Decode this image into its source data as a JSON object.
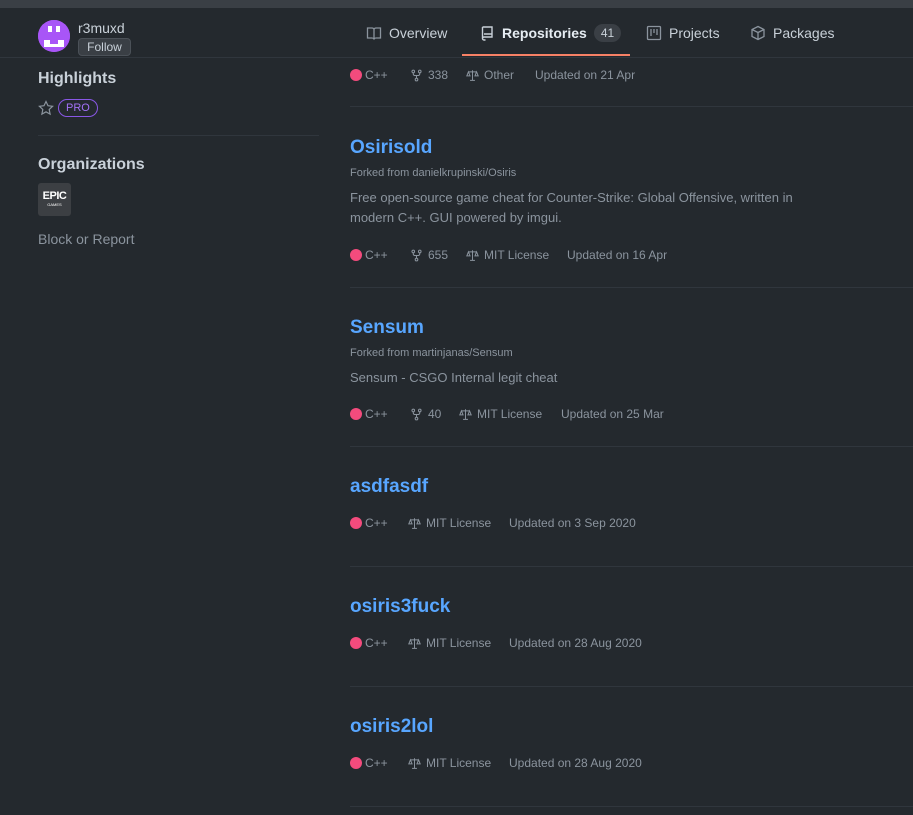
{
  "profile": {
    "username": "r3muxd",
    "follow_label": "Follow"
  },
  "tabs": [
    {
      "label": "Overview",
      "icon": "book-icon"
    },
    {
      "label": "Repositories",
      "icon": "repo-icon",
      "count": "41",
      "active": true
    },
    {
      "label": "Projects",
      "icon": "project-icon"
    },
    {
      "label": "Packages",
      "icon": "package-icon"
    }
  ],
  "sidebar": {
    "highlights_title": "Highlights",
    "pro_label": "PRO",
    "organizations_title": "Organizations",
    "org_logo_text": "EPIC",
    "org_logo_sub": "GAMES",
    "block_label": "Block or Report"
  },
  "repos": [
    {
      "name": "",
      "language": "C++",
      "forks": "338",
      "license": "Other",
      "updated": "Updated on 21 Apr"
    },
    {
      "name": "Osirisold",
      "forked_from": "Forked from danielkrupinski/Osiris",
      "description": "Free open-source game cheat for Counter-Strike: Global Offensive, written in modern C++. GUI powered by imgui.",
      "language": "C++",
      "forks": "655",
      "license": "MIT License",
      "updated": "Updated on 16 Apr"
    },
    {
      "name": "Sensum",
      "forked_from": "Forked from martinjanas/Sensum",
      "description": "Sensum - CSGO Internal legit cheat",
      "language": "C++",
      "forks": "40",
      "license": "MIT License",
      "updated": "Updated on 25 Mar"
    },
    {
      "name": "asdfasdf",
      "language": "C++",
      "license": "MIT License",
      "updated": "Updated on 3 Sep 2020"
    },
    {
      "name": "osiris3fuck",
      "language": "C++",
      "license": "MIT License",
      "updated": "Updated on 28 Aug 2020"
    },
    {
      "name": "osiris2lol",
      "language": "C++",
      "license": "MIT License",
      "updated": "Updated on 28 Aug 2020"
    }
  ],
  "colors": {
    "accent_link": "#58a6ff",
    "lang_cpp": "#f34b7d",
    "tab_underline": "#f78166",
    "pro": "#a371f7"
  }
}
